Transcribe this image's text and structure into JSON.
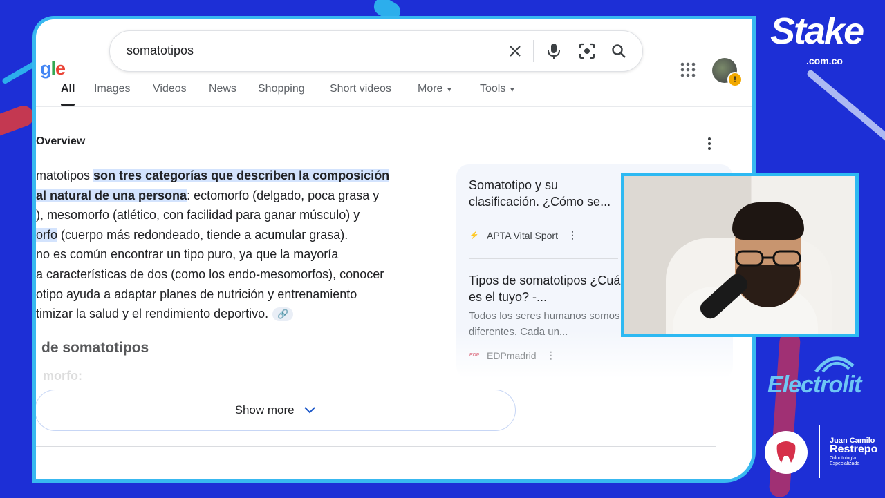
{
  "search": {
    "logo_fragment": "gle",
    "query": "somatotipos"
  },
  "tabs": [
    {
      "label": "All",
      "active": true
    },
    {
      "label": "Images"
    },
    {
      "label": "Videos"
    },
    {
      "label": "News"
    },
    {
      "label": "Shopping"
    },
    {
      "label": "Short videos"
    },
    {
      "label": "More"
    },
    {
      "label": "Tools"
    }
  ],
  "overview": {
    "title": "Overview",
    "p1_a": "matotipos ",
    "p1_hl": "son tres categorías que describen la composición",
    "p2_hl": "al natural de una persona",
    "p2_b": ": ectomorfo (delgado, poca grasa y",
    "p3": "), mesomorfo (atlético, con facilidad para ganar músculo) y",
    "p4_hl": "orfo",
    "p4_b": " (cuerpo más redondeado, tiende a acumular grasa).",
    "p5": " no es común encontrar un tipo puro, ya que la mayoría",
    "p6": "a características de dos (como los endo-mesomorfos), conocer",
    "p7": "otipo ayuda a adaptar planes de nutrición y entrenamiento",
    "p8": "timizar la salud y el rendimiento deportivo.",
    "subheading": "de somatotipos",
    "faded_item": "morfo:",
    "show_more": "Show more"
  },
  "sources": [
    {
      "title": "Somatotipo y su clasificación. ¿Cómo se...",
      "site": "APTA Vital Sport"
    },
    {
      "title": "Tipos de somatotipos ¿Cuál es el tuyo? -...",
      "desc": "Todos los seres humanos somos diferentes. Cada un...",
      "site": "EDPmadrid",
      "favicon": "EDP"
    }
  ],
  "branding": {
    "stake": "Stake",
    "stake_domain": ".com.co",
    "electrolit": "Electrolit",
    "sponsor_name1": "Juan Camilo",
    "sponsor_name2": "Restrepo",
    "sponsor_sub1": "Odontología",
    "sponsor_sub2": "Especializada"
  },
  "colors": {
    "background": "#1d2fd6",
    "frame_border": "#38b8f0",
    "highlight": "#d3e3fd",
    "google_blue": "#4285f4",
    "google_red": "#ea4335",
    "google_yellow": "#fbbc05",
    "google_green": "#34a853"
  },
  "icons": [
    "clear-icon",
    "mic-icon",
    "lens-icon",
    "search-icon",
    "apps-icon",
    "more-vert-icon",
    "link-icon",
    "chevron-down-icon"
  ]
}
